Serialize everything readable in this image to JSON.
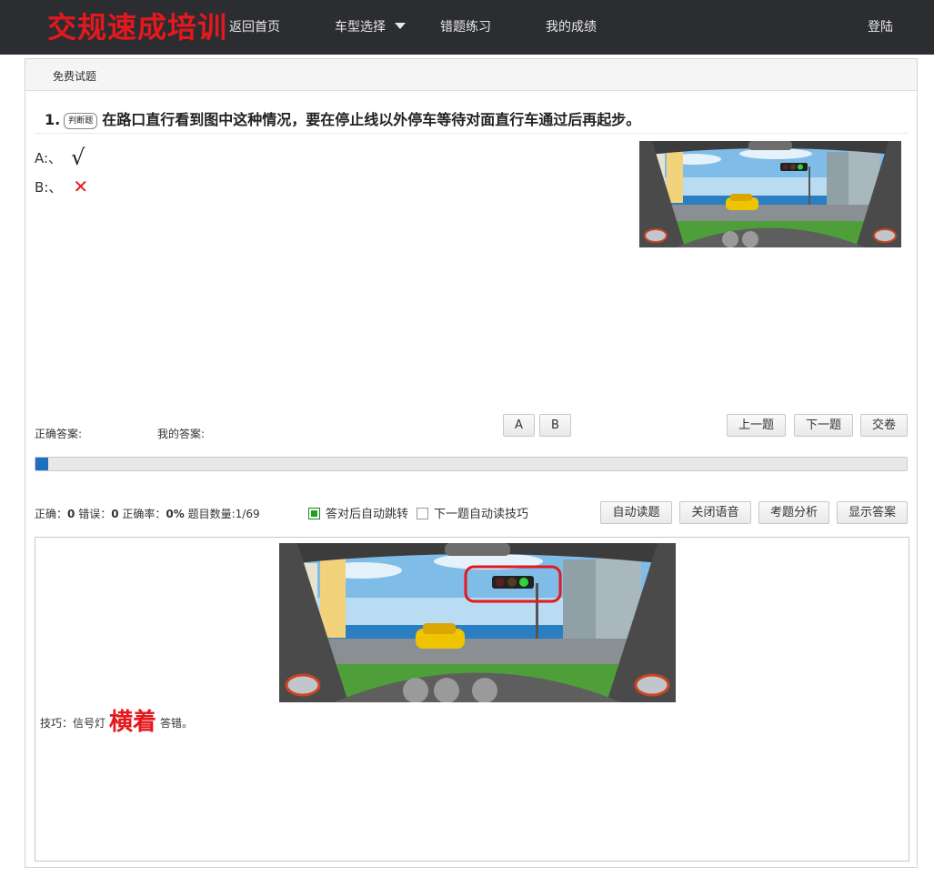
{
  "brand": "交规速成培训",
  "nav": {
    "home": "返回首页",
    "car_type": "车型选择",
    "wrong": "错题练习",
    "score": "我的成绩",
    "login": "登陆"
  },
  "panel": {
    "header": "免费试题"
  },
  "question": {
    "number": "1.",
    "tag": "判断题",
    "text": "在路口直行看到图中这种情况，要在停止线以外停车等待对面直行车通过后再起步。",
    "options": [
      {
        "label": "A:、",
        "mark": "√"
      },
      {
        "label": "B:、",
        "mark": "✕"
      }
    ]
  },
  "answers": {
    "correct_label": "正确答案:",
    "mine_label": "我的答案:"
  },
  "choice_buttons": {
    "a": "A",
    "b": "B"
  },
  "nav_buttons": {
    "prev": "上一题",
    "next": "下一题",
    "submit": "交卷"
  },
  "progress": {
    "fraction": 0.0145
  },
  "stats": {
    "correct_label": "正确：",
    "correct_value": "0",
    "wrong_label": "错误：",
    "wrong_value": "0",
    "rate_label": "正确率：",
    "rate_value": "0%",
    "count_label": "题目数量:",
    "count_value": "1/69"
  },
  "options": {
    "auto_jump": {
      "label": "答对后自动跳转",
      "checked": true
    },
    "auto_read_tip": {
      "label": "下一题自动读技巧",
      "checked": false
    }
  },
  "tool_buttons": {
    "auto_read": "自动读题",
    "close_voice": "关闭语音",
    "analysis": "考题分析",
    "show_answer": "显示答案"
  },
  "tip": {
    "prefix": "技巧：信号灯",
    "keyword": "横着",
    "suffix": "答错。"
  },
  "colors": {
    "brand": "#e4181d",
    "topbar": "#2b2d31",
    "progress": "#1e6fc0",
    "checkbox_on": "#1aa51a"
  }
}
